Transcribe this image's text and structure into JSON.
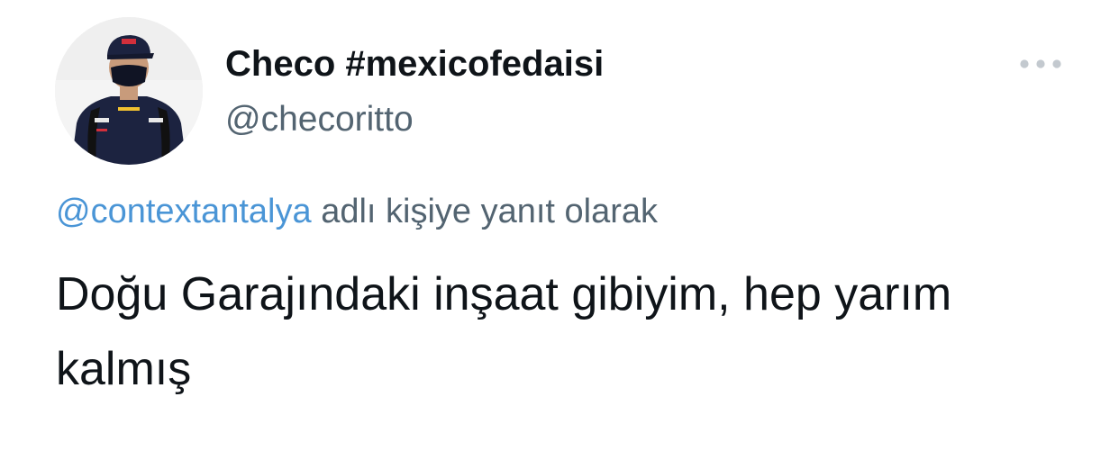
{
  "author": {
    "display_name": "Checo #mexicofedaisi",
    "handle": "@checoritto",
    "avatar_icon": "profile-photo-icon"
  },
  "more_icon": "more-horizontal-icon",
  "reply": {
    "mention": "@contextantalya",
    "suffix": "adlı kişiye yanıt olarak"
  },
  "tweet": {
    "text": "Doğu Garajındaki inşaat gibiyim, hep yarım kalmış"
  },
  "colors": {
    "link": "#4a95d6",
    "secondary_text": "#536471",
    "primary_text": "#0f1419"
  }
}
